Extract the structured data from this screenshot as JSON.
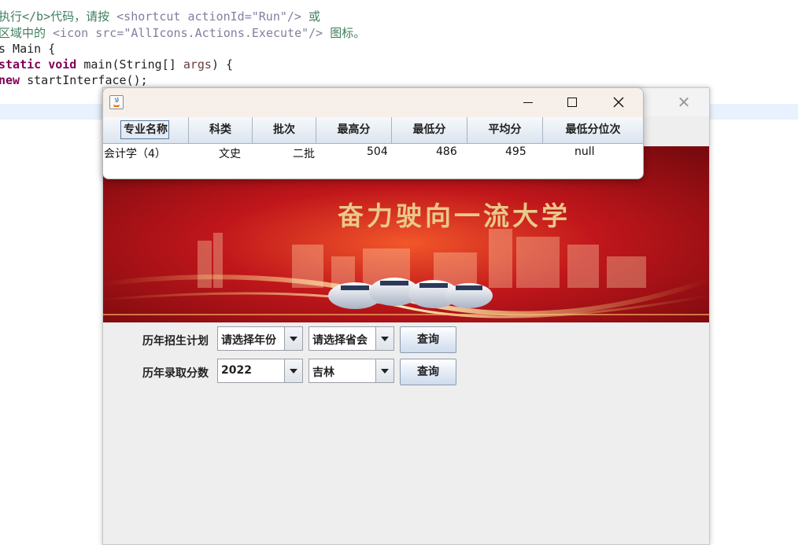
{
  "ide": {
    "line1": {
      "a": "执行</b>代码，请按 ",
      "b": "<shortcut actionId=\"Run\"/>",
      "c": " 或"
    },
    "line2": {
      "a": "区域中的 ",
      "b": "<icon src=\"AllIcons.Actions.Execute\"/>",
      "c": " 图标。"
    },
    "line3": "s Main {",
    "line4": {
      "kw1": "static void",
      "rest": " main(String[] ",
      "param": "args",
      "end": ") {"
    },
    "line5": {
      "kw": "new",
      "rest": " startInterface();"
    }
  },
  "main_window": {
    "row1": {
      "label": "历年招生计划",
      "year": "请选择年份",
      "province": "请选择省会",
      "query": "查询"
    },
    "row2": {
      "label": "历年录取分数",
      "year": "2022",
      "province": "吉林",
      "query": "查询"
    }
  },
  "banner": {
    "slogan": "奋力驶向一流大学"
  },
  "dialog": {
    "columns": [
      "专业名称",
      "科类",
      "批次",
      "最高分",
      "最低分",
      "平均分",
      "最低分位次"
    ],
    "rows": [
      [
        "会计学（4）",
        "文史",
        "二批",
        "504",
        "486",
        "495",
        "null"
      ]
    ]
  },
  "colors": {
    "banner_red": "#c0161b",
    "gold": "#e8c98a",
    "title_bar": "#f7efe9"
  }
}
